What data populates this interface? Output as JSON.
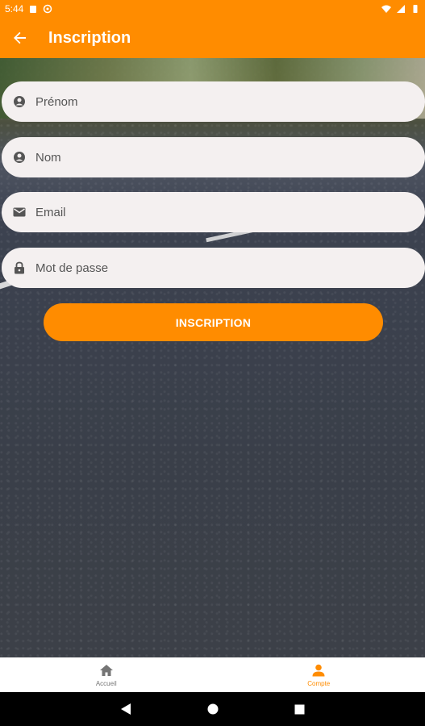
{
  "status_bar": {
    "time": "5:44"
  },
  "app_bar": {
    "title": "Inscription"
  },
  "form": {
    "first_name_placeholder": "Prénom",
    "last_name_placeholder": "Nom",
    "email_placeholder": "Email",
    "password_placeholder": "Mot de passe",
    "submit_label": "INSCRIPTION"
  },
  "bottom_nav": {
    "items": [
      {
        "label": "Accueil",
        "icon": "home-icon",
        "active": false
      },
      {
        "label": "Compte",
        "icon": "account-icon",
        "active": true
      }
    ]
  },
  "colors": {
    "accent": "#ff8c00",
    "field_bg": "#f4f0f0"
  }
}
